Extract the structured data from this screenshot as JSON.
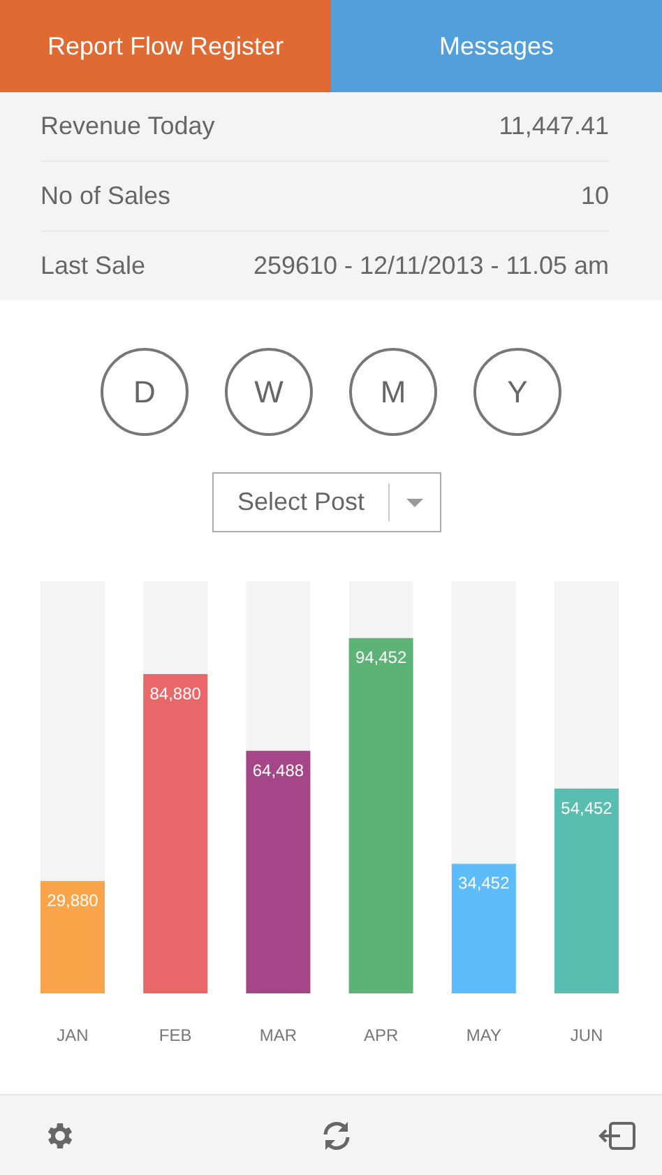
{
  "tabs": [
    {
      "label": "Report Flow Register",
      "color": "#e06a34"
    },
    {
      "label": "Messages",
      "color": "#529fdc"
    }
  ],
  "summary": [
    {
      "label": "Revenue Today",
      "value": "11,447.41"
    },
    {
      "label": "No of Sales",
      "value": "10"
    },
    {
      "label": "Last Sale",
      "value": "259610 - 12/11/2013 - 11.05 am"
    }
  ],
  "periods": [
    "D",
    "W",
    "M",
    "Y"
  ],
  "post_select": {
    "value": "Select Post"
  },
  "chart_data": {
    "type": "bar",
    "categories": [
      "JAN",
      "FEB",
      "MAR",
      "APR",
      "MAY",
      "JUN"
    ],
    "values": [
      29880,
      84880,
      64488,
      94452,
      34452,
      54452
    ],
    "value_labels": [
      "29,880",
      "84,880",
      "64,488",
      "94,452",
      "34,452",
      "54,452"
    ],
    "colors": [
      "#fba54a",
      "#ea6769",
      "#a54689",
      "#5db375",
      "#5ebcfa",
      "#58bfb0"
    ]
  }
}
